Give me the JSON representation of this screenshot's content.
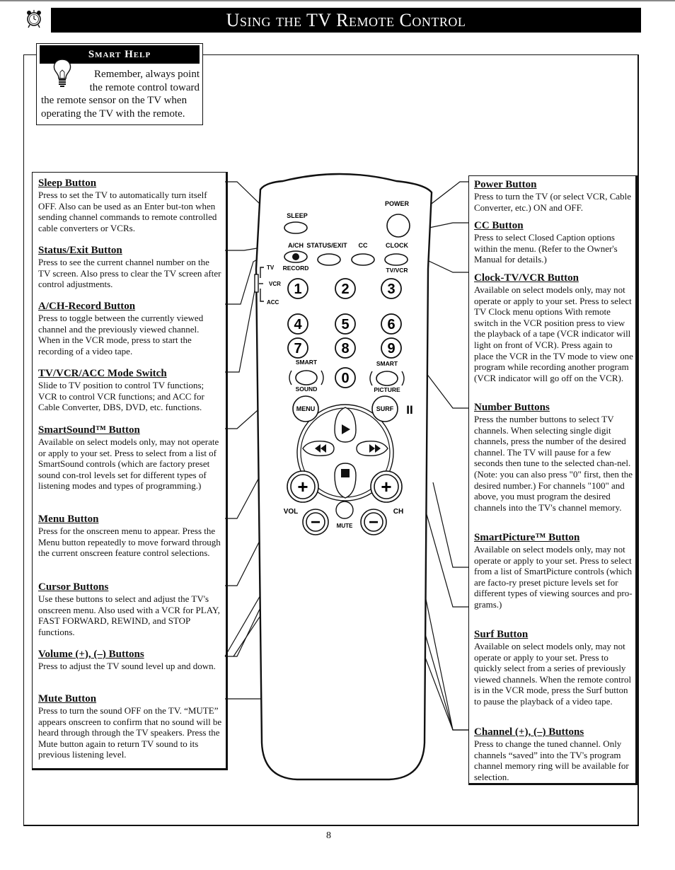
{
  "page": {
    "title": "Using the TV Remote Control",
    "page_number": "8"
  },
  "smart_help": {
    "heading": "Smart Help",
    "lines": [
      "Remember, always point",
      "the remote control toward",
      "the remote sensor on the TV when",
      "operating the TV with the remote."
    ]
  },
  "left_entries": [
    {
      "title": "Sleep Button",
      "text": "Press to set the TV to automatically turn itself OFF. Also can be used as an Enter but-ton when sending channel commands to remote controlled cable converters or VCRs."
    },
    {
      "title": "Status/Exit Button",
      "text": "Press to see the current channel number on the TV screen. Also press to clear the TV screen after control adjustments."
    },
    {
      "title": "A/CH-Record Button",
      "text": "Press to toggle between the currently viewed channel and the previously viewed channel. When in the VCR mode, press to start the recording of a video tape."
    },
    {
      "title": "TV/VCR/ACC Mode Switch",
      "text": "Slide to TV position to control TV functions; VCR to control VCR functions; and ACC for Cable Converter, DBS, DVD, etc. functions."
    },
    {
      "title": "SmartSound™ Button",
      "text": "Available on select models only, may not operate or apply to your set. Press to select from a list of SmartSound controls (which are factory preset sound con-trol levels set for different types of listening modes and types of programming.)"
    },
    {
      "title": "Menu Button",
      "text": "Press for the onscreen menu to appear. Press the Menu button repeatedly to move forward through the current onscreen feature control selections."
    },
    {
      "title": "Cursor Buttons",
      "text": "Use these buttons to select and adjust the TV's onscreen menu. Also used with a VCR for PLAY, FAST FORWARD, REWIND, and STOP functions."
    },
    {
      "title": "Volume (+), (–) Buttons",
      "text": "Press to adjust the TV sound level up and down."
    },
    {
      "title": "Mute Button",
      "text": "Press to turn the sound OFF on the TV. “MUTE” appears onscreen to confirm that no sound will be heard through through the TV speakers. Press the Mute button again to return TV sound to its previous listening level."
    }
  ],
  "right_entries": [
    {
      "title": "Power Button",
      "text": "Press to turn the TV (or select VCR, Cable Converter, etc.) ON and OFF."
    },
    {
      "title": "CC Button",
      "text": "Press to select Closed Caption options within the menu. (Refer to the Owner's Manual for details.)"
    },
    {
      "title": "Clock-TV/VCR Button",
      "text": "Available on select models only, may not operate or apply to your set. Press to select TV Clock menu options With remote switch in the VCR position press to view the playback of a tape (VCR indicator will light on front of VCR). Press again to place the VCR in the TV mode to view one program while recording another program (VCR indicator will go off on the VCR)."
    },
    {
      "title": "Number Buttons",
      "text": "Press the number buttons to select TV channels. When selecting single digit channels, press the number of the desired channel. The TV will pause for a few seconds then tune to the selected chan-nel. (Note: you can also press \"0\" first, then the desired number.) For channels \"100\" and above, you must program the desired channels into the TV's channel memory."
    },
    {
      "title": "SmartPicture™ Button",
      "text": "Available on select models only, may not operate or apply to your set. Press to select from a list of SmartPicture controls (which are facto-ry preset picture levels set for different types of viewing sources and pro-grams.)"
    },
    {
      "title": "Surf Button",
      "text": "Available on select models only, may not operate or apply to your set. Press to quickly select from a series of previously viewed channels. When the remote control is in the VCR mode, press the Surf button to pause the playback of a video tape."
    },
    {
      "title": "Channel (+), (–) Buttons",
      "text": "Press to change the tuned channel. Only channels “saved” into the TV's program channel memory ring will be available for selection."
    }
  ],
  "remote": {
    "labels": {
      "sleep": "SLEEP",
      "power": "POWER",
      "ach": "A/CH",
      "status_exit": "STATUS/EXIT",
      "cc": "CC",
      "clock": "CLOCK",
      "record": "RECORD",
      "tvvcr": "TV/VCR",
      "mode_tv": "TV",
      "mode_vcr": "VCR",
      "mode_acc": "ACC",
      "smart_sound_top": "SMART",
      "smart_sound_bottom": "SOUND",
      "smart_picture_top": "SMART",
      "smart_picture_bottom": "PICTURE",
      "menu": "MENU",
      "surf": "SURF",
      "vol": "VOL",
      "ch": "CH",
      "mute": "MUTE",
      "pause": "II"
    },
    "digits": [
      "1",
      "2",
      "3",
      "4",
      "5",
      "6",
      "7",
      "8",
      "9",
      "0"
    ],
    "symbols": {
      "plus": "+",
      "minus": "−"
    }
  },
  "icons": {
    "header": "alarm-clock-icon",
    "smart_help": "light-bulb-icon"
  }
}
